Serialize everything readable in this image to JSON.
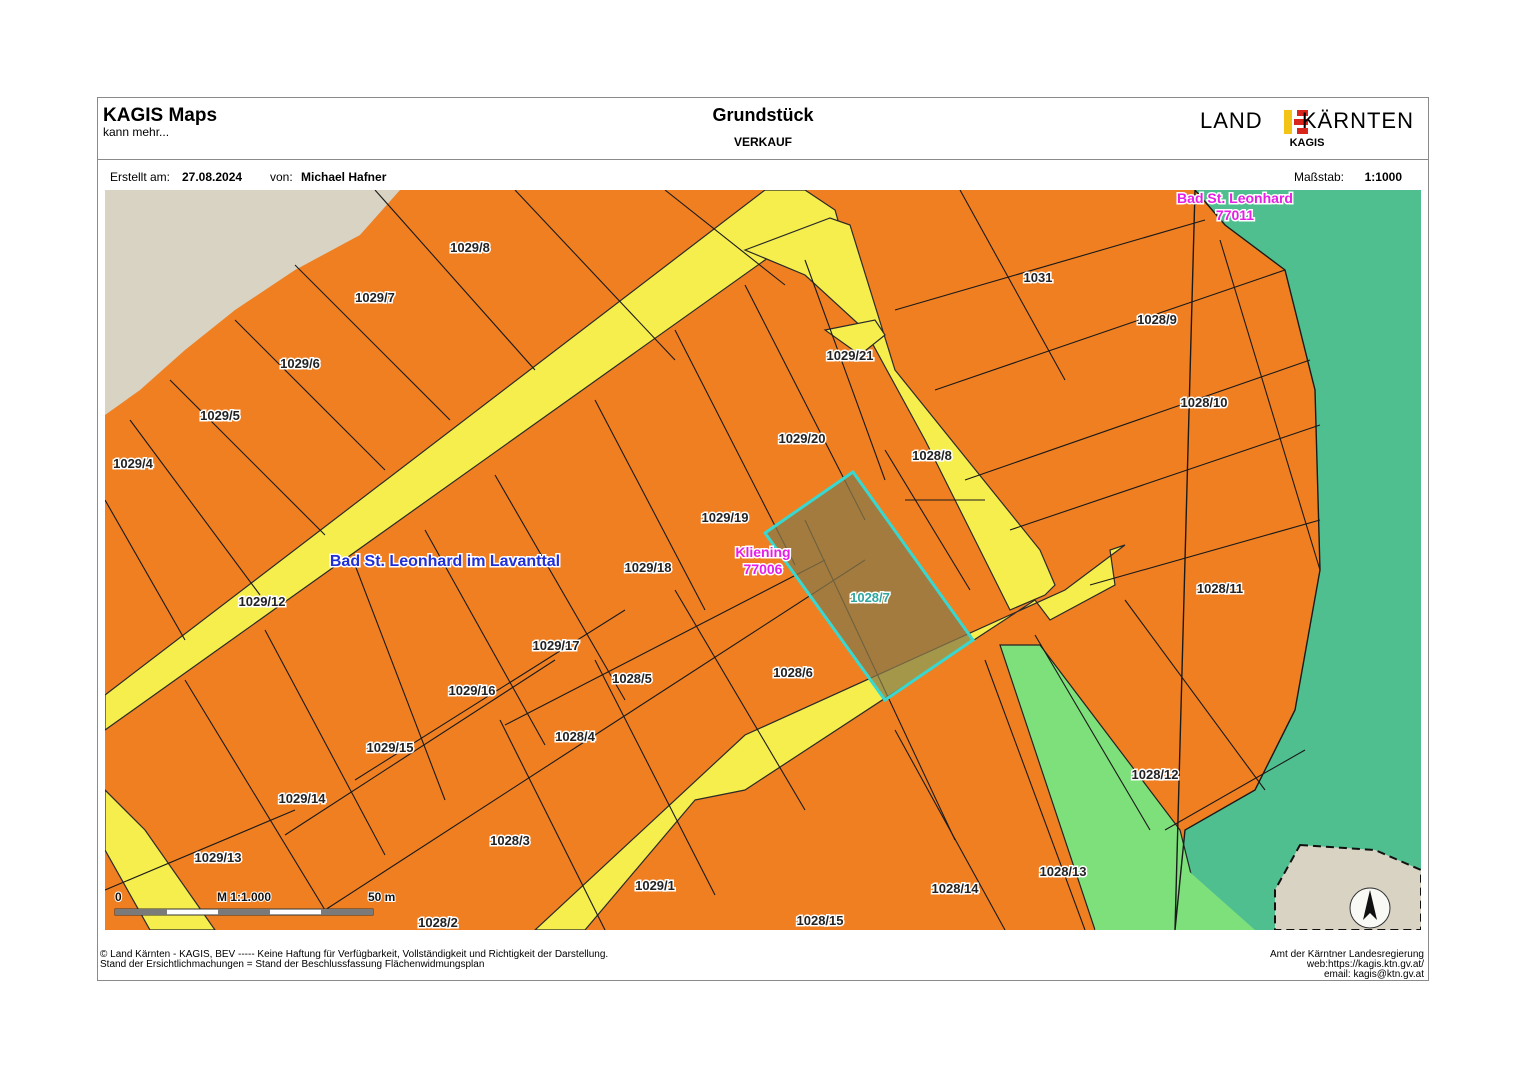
{
  "header": {
    "brand_title": "KAGIS Maps",
    "brand_subtitle": "kann mehr...",
    "title": "Grundstück",
    "subtitle": "VERKAUF",
    "logo_left": "LAND",
    "logo_right": "KÄRNTEN",
    "logo_sub": "KAGIS"
  },
  "info": {
    "created_label": "Erstellt am:",
    "created_value": "27.08.2024",
    "author_label": "von:",
    "author_value": "Michael Hafner",
    "scale_label": "Maßstab:",
    "scale_value": "1:1000"
  },
  "map": {
    "colors": {
      "building_zone": "#f07f22",
      "road": "#f5ee4c",
      "green_zone": "#7ee07a",
      "forest": "#4fbf8f",
      "other_land": "#d8d3c3",
      "selected_parcel_outline": "#38d8d0",
      "label_municipality": "#1f2fd8",
      "label_cadastral": "#e61ee6"
    },
    "parcel_labels": [
      "1029/8",
      "1029/7",
      "1029/6",
      "1029/5",
      "1029/4",
      "1029/12",
      "1029/13",
      "1029/14",
      "1029/15",
      "1029/16",
      "1029/17",
      "1029/18",
      "1029/19",
      "1029/20",
      "1029/21",
      "1031",
      "1028/9",
      "1028/10",
      "1028/8",
      "1028/7",
      "1028/6",
      "1028/5",
      "1028/4",
      "1028/3",
      "1028/2",
      "1029/1",
      "1028/15",
      "1028/14",
      "1028/13",
      "1028/12",
      "1028/11"
    ],
    "municipality_label": "Bad St. Leonhard im Lavanttal",
    "cadastral_labels": [
      {
        "name": "Bad St. Leonhard",
        "code": "77011"
      },
      {
        "name": "Kliening",
        "code": "77006"
      }
    ],
    "selected_parcel": "1028/7",
    "north_arrow": "north-arrow-icon",
    "scalebar": {
      "start": "0",
      "label": "M 1:1.000",
      "end": "50 m"
    }
  },
  "footer": {
    "left_line1": "© Land Kärnten - KAGIS, BEV ----- Keine Haftung für Verfügbarkeit, Vollständigkeit und Richtigkeit der Darstellung.",
    "left_line2": "Stand der Ersichtlichmachungen = Stand der Beschlussfassung Flächenwidmungsplan",
    "right_line1": "Amt der Kärntner Landesregierung",
    "right_line2": "web:https://kagis.ktn.gv.at/",
    "right_line3": "email: kagis@ktn.gv.at"
  }
}
